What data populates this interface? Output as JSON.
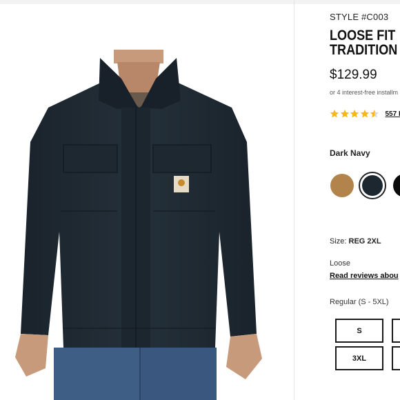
{
  "product": {
    "style_number": "STYLE #C003",
    "title_line1": "LOOSE FIT",
    "title_line2": "TRADITION",
    "price": "$129.99",
    "installments_text": "or 4 interest-free installm",
    "rating": {
      "stars_value": 4.5,
      "stars_max": 5,
      "review_count_text": "557 R",
      "star_color": "#f5b817"
    },
    "image_alt": "Man wearing a dark navy duck traditional coat with corduroy collar"
  },
  "color_selector": {
    "selected_label": "Dark Navy",
    "swatches": [
      {
        "name": "brown-swatch",
        "color": "#b3834c"
      },
      {
        "name": "dark-navy-swatch",
        "color": "#1d2730",
        "selected": true
      },
      {
        "name": "black-swatch",
        "color": "#0b0b0b"
      }
    ]
  },
  "size": {
    "label_prefix": "Size:",
    "selected_value": "REG 2XL",
    "fit_text": "Loose",
    "reviews_link": "Read reviews abou",
    "range_text": "Regular (S - 5XL)",
    "buttons": [
      "S",
      "3XL",
      "",
      ""
    ]
  },
  "colors": {
    "jacket": "#1f2a33",
    "accent_star": "#f5b817",
    "text": "#111111"
  }
}
